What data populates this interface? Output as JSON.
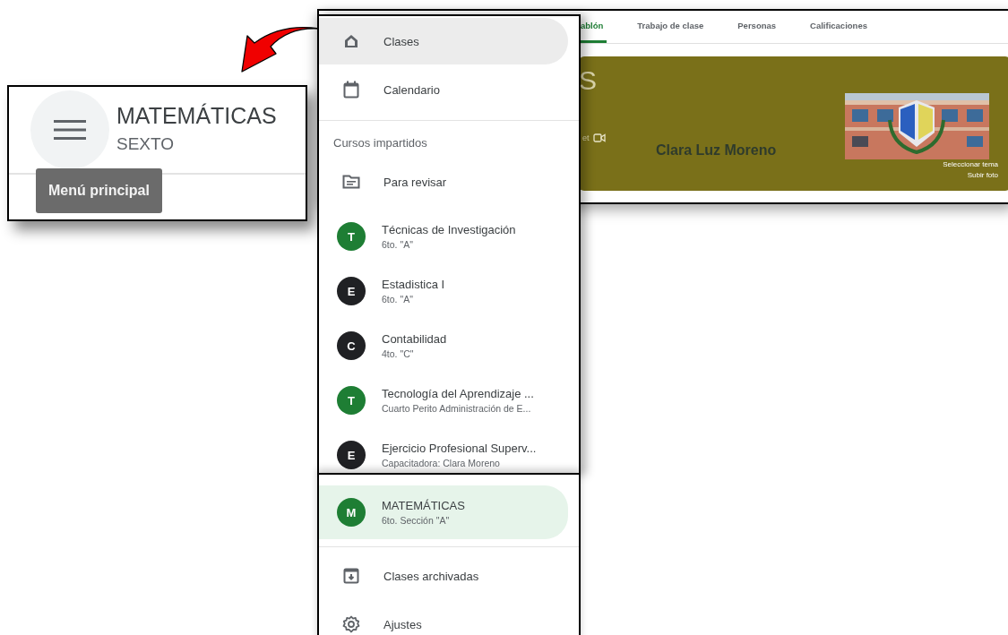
{
  "class_window": {
    "tabs": [
      {
        "label": "ablón",
        "selected": true
      },
      {
        "label": "Trabajo de clase",
        "selected": false
      },
      {
        "label": "Personas",
        "selected": false
      },
      {
        "label": "Calificaciones",
        "selected": false
      }
    ],
    "banner": {
      "title_fragment": "S",
      "meet_fragment": "et",
      "teacher": "Clara Luz Moreno",
      "links": [
        "Seleccionar tema",
        "Subir foto"
      ]
    }
  },
  "callout": {
    "title": "MATEMÁTICAS",
    "subtitle": "SEXTO",
    "tooltip": "Menú principal"
  },
  "drawer": {
    "top_items": [
      {
        "kind": "home",
        "label": "Clases",
        "selected": true
      },
      {
        "kind": "calendar",
        "label": "Calendario",
        "selected": false
      }
    ],
    "section_title": "Cursos impartidos",
    "review_item": {
      "kind": "review",
      "label": "Para revisar"
    },
    "courses": [
      {
        "letter": "T",
        "name": "Técnicas de Investigación",
        "section": "6to. \"A\"",
        "color": "#1e7e34"
      },
      {
        "letter": "E",
        "name": "Estadistica I",
        "section": "6to. \"A\"",
        "color": "#202124"
      },
      {
        "letter": "C",
        "name": "Contabilidad",
        "section": "4to. \"C\"",
        "color": "#202124"
      },
      {
        "letter": "T",
        "name": "Tecnología del Aprendizaje ...",
        "section": "Cuarto Perito Administración de E...",
        "color": "#1e7e34"
      },
      {
        "letter": "E",
        "name": "Ejercicio Profesional Superv...",
        "section": "Capacitadora: Clara Moreno",
        "color": "#202124"
      }
    ]
  },
  "drawer_bottom": {
    "current_course": {
      "letter": "M",
      "name": "MATEMÁTICAS",
      "section": "6to. Sección \"A\"",
      "color": "#1e7e34",
      "selected": true
    },
    "items": [
      {
        "kind": "archive",
        "label": "Clases archivadas"
      },
      {
        "kind": "settings",
        "label": "Ajustes"
      }
    ]
  }
}
